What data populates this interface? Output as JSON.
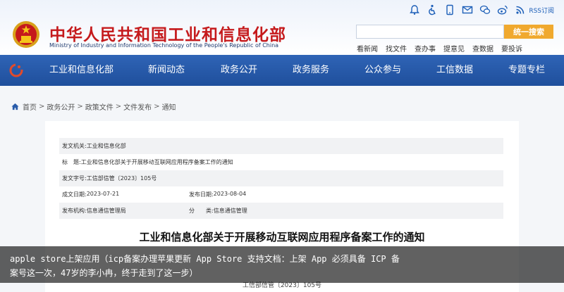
{
  "header": {
    "title_cn": "中华人民共和国工业和信息化部",
    "title_en": "Ministry of Industry and Information Technology of the People's Republic of China",
    "rss_label": "RSS订阅",
    "top_icons": [
      "bell-icon",
      "accessibility-icon",
      "mobile-icon",
      "mail-icon",
      "wechat-icon",
      "weibo-icon",
      "rss-icon"
    ],
    "search": {
      "placeholder": "",
      "button_label": "统一搜索"
    },
    "quick_links": [
      "看新闻",
      "找文件",
      "查办事",
      "提意见",
      "查数据",
      "要投诉"
    ]
  },
  "nav": {
    "items": [
      "工业和信息化部",
      "新闻动态",
      "政务公开",
      "政务服务",
      "公众参与",
      "工信数据",
      "专题专栏"
    ]
  },
  "breadcrumb": {
    "items": [
      "首页",
      "政务公开",
      "政策文件",
      "文件发布",
      "通知"
    ],
    "separator": ">"
  },
  "document": {
    "meta": {
      "issuer_label": "发文机关:",
      "issuer": "工业和信息化部",
      "subject_label": "标　题:",
      "subject": "工业和信息化部关于开展移动互联网应用程序备案工作的通知",
      "doc_no_label": "发文字号:",
      "doc_no": "工信部信管〔2023〕105号",
      "created_label": "成文日期:",
      "created": "2023-07-21",
      "published_label": "发布日期:",
      "published": "2023-08-04",
      "office_label": "发布机构:",
      "office": "信息通信管理局",
      "category_label": "分　　类:",
      "category": "信息通信管理"
    },
    "title": "工业和信息化部关于开展移动互联网应用程序备案工作的通知",
    "number_line": "工信部信管〔2023〕105号"
  },
  "caption": {
    "text": "apple store上架应用（icp备案办理苹果更新 App Store 支持文档：上架 App 必须具备 ICP 备案号这一次，47岁的李小冉，终于走到了这一步）"
  },
  "colors": {
    "brand_red": "#c51a1c",
    "nav_blue": "#2a5caa",
    "search_orange": "#f0a92e"
  }
}
